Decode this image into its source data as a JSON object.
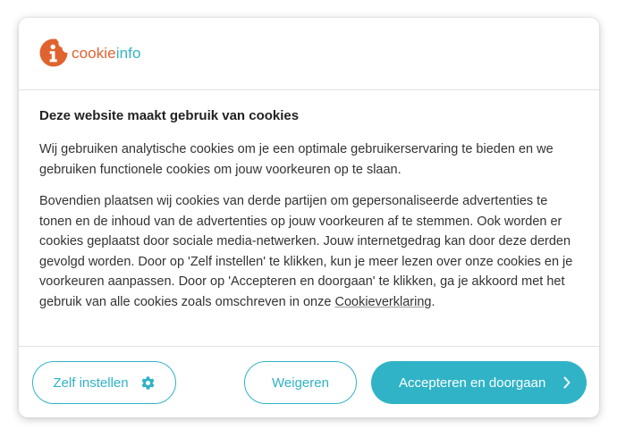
{
  "logo": {
    "text_part1": "cookie",
    "text_part2": "info",
    "mark_icon": "cookie-info-icon",
    "colors": {
      "orange": "#e0622f",
      "teal": "#30b3c6"
    }
  },
  "dialog": {
    "title": "Deze website maakt gebruik van cookies",
    "paragraph1": "Wij gebruiken analytische cookies om je een optimale gebruikerservaring te bieden en we gebruiken functionele cookies om jouw voorkeuren op te slaan.",
    "paragraph2": "Bovendien plaatsen wij cookies van derde partijen om gepersonaliseerde advertenties te tonen en de inhoud van de advertenties op jouw voorkeuren af te stemmen. Ook worden er cookies geplaatst door sociale media-netwerken. Jouw internetgedrag kan door deze derden gevolgd worden. Door op 'Zelf instellen' te klikken, kun je meer lezen over onze cookies en je voorkeuren aanpassen. Door op 'Accepteren en doorgaan' te klikken, ga je akkoord met het gebruik van alle cookies zoals omschreven in onze ",
    "link_label": "Cookieverklaring",
    "paragraph2_end": "."
  },
  "buttons": {
    "settings_label": "Zelf instellen",
    "settings_icon": "gear-icon",
    "refuse_label": "Weigeren",
    "accept_label": "Accepteren en doorgaan",
    "accept_icon": "chevron-right-icon"
  },
  "colors": {
    "accent": "#30b3c6",
    "text": "#333333",
    "title": "#222222",
    "divider": "#e2e2e2"
  }
}
